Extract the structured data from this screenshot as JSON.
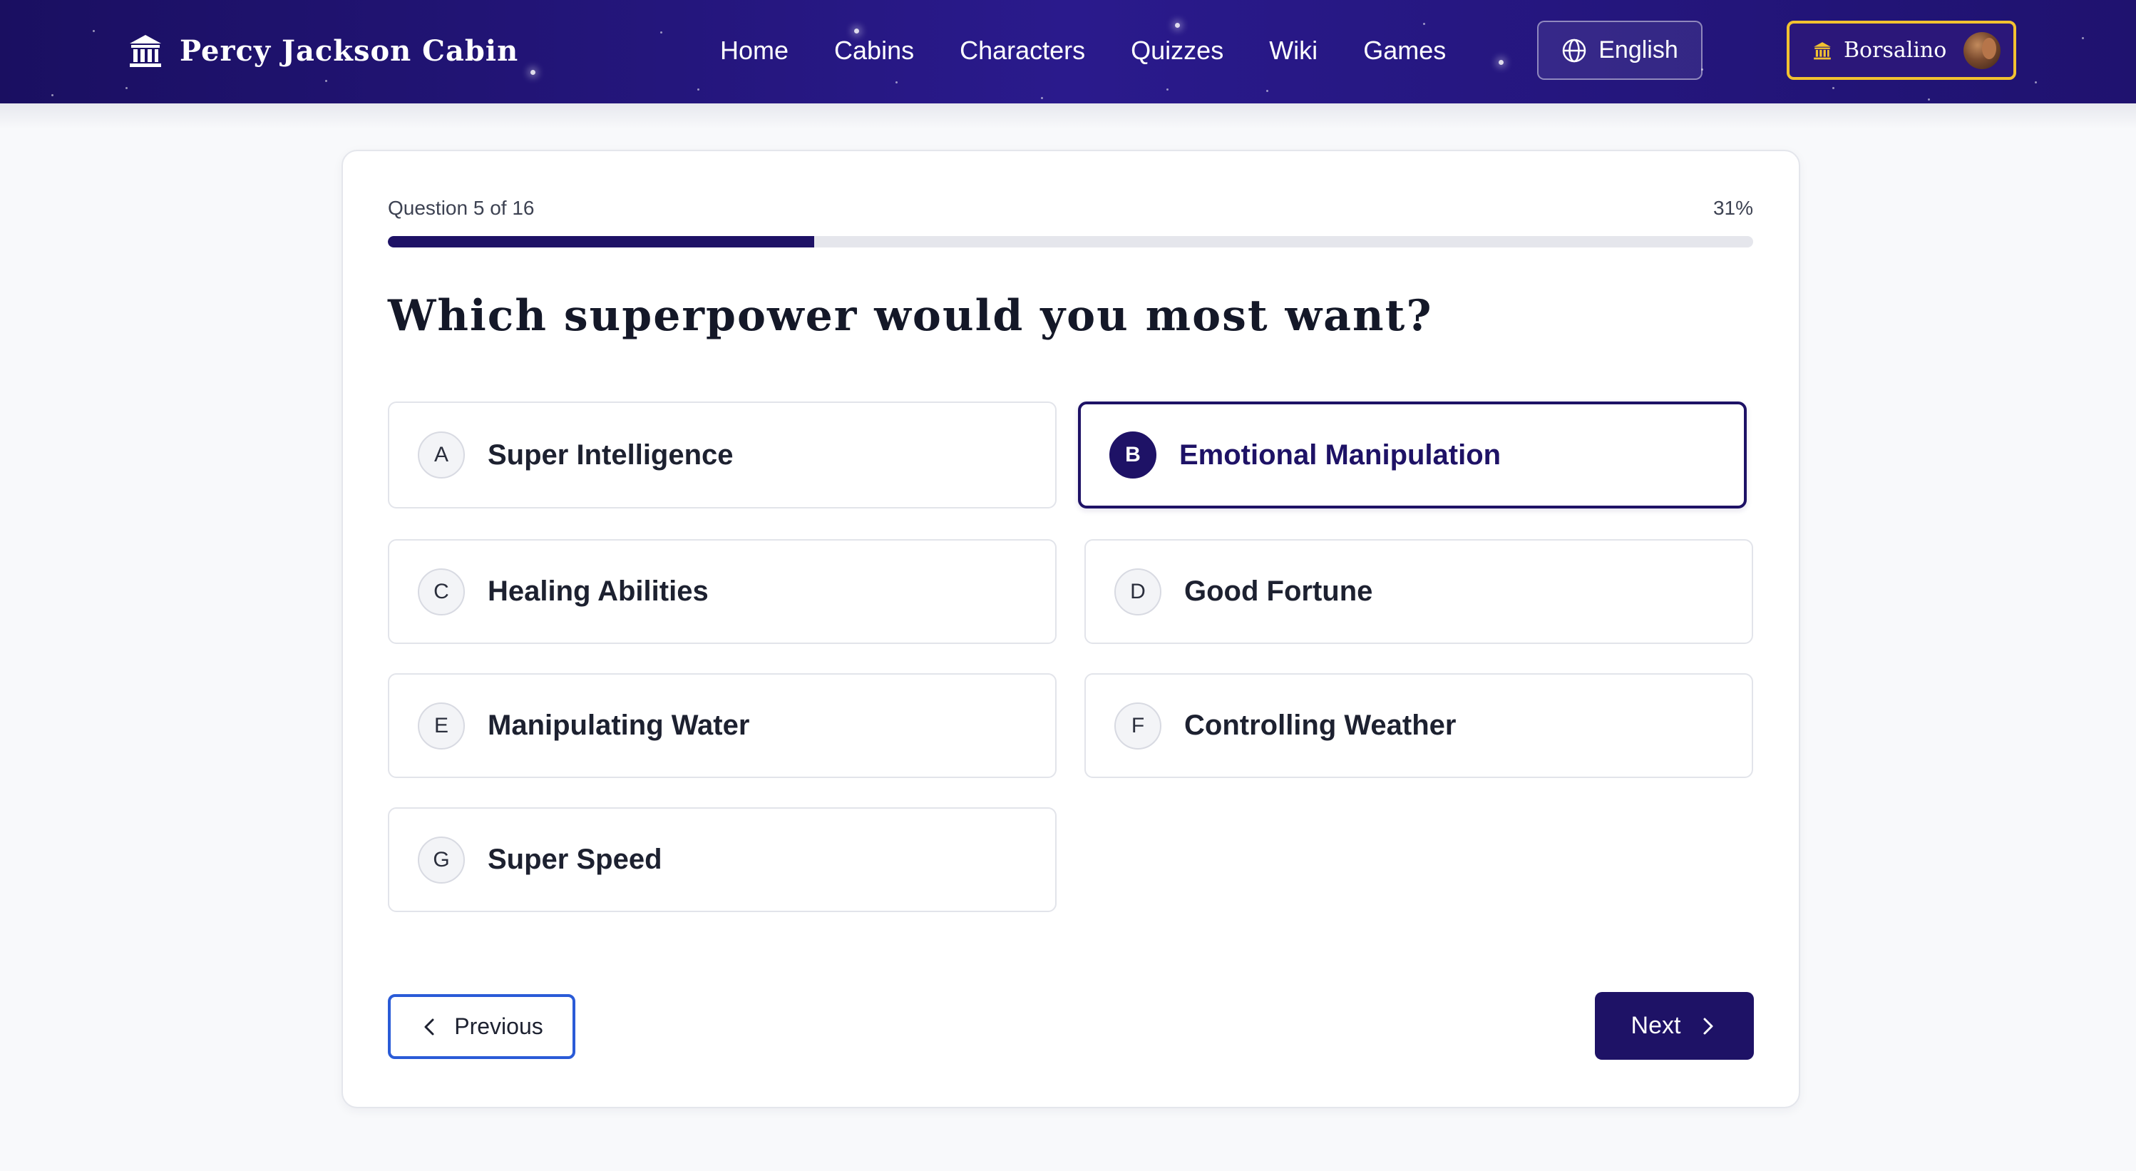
{
  "header": {
    "brand": "Percy Jackson Cabin",
    "brand_icon": "temple-icon",
    "nav": [
      {
        "label": "Home"
      },
      {
        "label": "Cabins"
      },
      {
        "label": "Characters"
      },
      {
        "label": "Quizzes"
      },
      {
        "label": "Wiki"
      },
      {
        "label": "Games"
      }
    ],
    "language": {
      "label": "English",
      "icon": "globe-icon"
    },
    "user": {
      "name": "Borsalino",
      "icon": "temple-icon",
      "avatar": "avatar"
    }
  },
  "quiz": {
    "progress_label": "Question 5 of 16",
    "progress_percent": "31%",
    "progress_fraction": 0.3125,
    "question": "Which superpower would you most want?",
    "selected_letter": "B",
    "options": [
      {
        "letter": "A",
        "label": "Super Intelligence"
      },
      {
        "letter": "B",
        "label": "Emotional Manipulation"
      },
      {
        "letter": "C",
        "label": "Healing Abilities"
      },
      {
        "letter": "D",
        "label": "Good Fortune"
      },
      {
        "letter": "E",
        "label": "Manipulating Water"
      },
      {
        "letter": "F",
        "label": "Controlling Weather"
      },
      {
        "letter": "G",
        "label": "Super Speed"
      }
    ],
    "previous_label": "Previous",
    "next_label": "Next"
  },
  "colors": {
    "header_bg": "#1a0f61",
    "primary": "#1e1266",
    "accent_gold": "#f2c230",
    "outline_blue": "#2a5bd7"
  }
}
